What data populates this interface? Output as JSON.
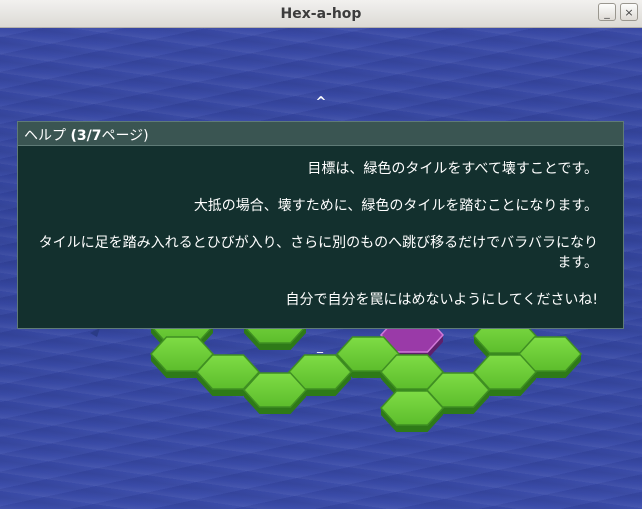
{
  "window": {
    "title": "Hex-a-hop",
    "minimize_glyph": "_",
    "close_glyph": "×"
  },
  "game": {
    "scroll_up_glyph": "^",
    "cursor_glyph": "_",
    "background_color": "#3a4aa6",
    "tile_colors": {
      "green": "#6ccc36",
      "green_dark": "#2e7a18",
      "purple": "#9a3aa8"
    }
  },
  "help": {
    "heading_prefix": "ヘルプ",
    "page_indicator": "(3/7",
    "page_suffix": "ページ)",
    "lines": [
      "目標は、緑色のタイルをすべて壊すことです。",
      "大抵の場合、壊すために、緑色のタイルを踏むことになります。",
      "タイルに足を踏み入れるとひびが入り、さらに別のものへ跳び移るだけでバラバラになります。",
      "自分で自分を罠にはめないようにしてくださいね!"
    ]
  }
}
